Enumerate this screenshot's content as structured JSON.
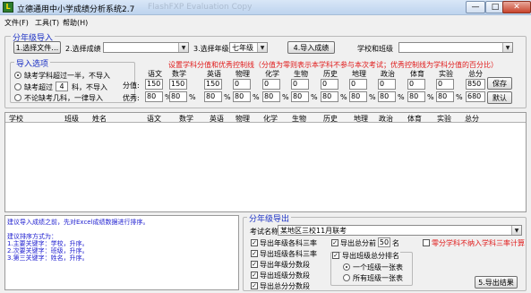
{
  "window": {
    "title": "立德通用中小学成绩分析系统2.7",
    "watermark": "FlashFXP Evaluation Copy",
    "btn_min": "—",
    "btn_max": "□",
    "btn_close": "✕"
  },
  "menu": {
    "file": "文件(F)",
    "tools": "工具(T)",
    "help": "帮助(H)"
  },
  "import_group": {
    "title": "分年级导入",
    "select_file": "1.选择文件…",
    "select_score_label": "2.选择成绩",
    "select_score_value": "",
    "select_grade_label": "3.选择年级",
    "select_grade_value": "七年级",
    "import_button": "4.导入成绩",
    "school_class_label": "学校和班级",
    "school_class_value": ""
  },
  "import_options": {
    "title": "导入选项",
    "opt1": "缺考学科超过一半，不导入",
    "opt2_pre": "缺考超过",
    "opt2_value": "4",
    "opt2_post": "科，不导入",
    "opt3": "不论缺考几科，一律导入"
  },
  "score_settings": {
    "hint": "设置学科分值和优秀控制线（分值为零则表示本学科不参与本次考试；优秀控制线为学科分值的百分比）",
    "subjects": [
      "语文",
      "数学",
      "英语",
      "物理",
      "化学",
      "生物",
      "历史",
      "地理",
      "政治",
      "体育",
      "实验",
      "总分"
    ],
    "score_label": "分值:",
    "scores": [
      "150",
      "150",
      "150",
      "0",
      "0",
      "0",
      "0",
      "0",
      "0",
      "0",
      "0",
      "850"
    ],
    "excellent_label": "优秀:",
    "excellent": [
      "80",
      "80",
      "80",
      "80",
      "80",
      "80",
      "80",
      "80",
      "80",
      "80",
      "80",
      "680"
    ],
    "percent_sign": "%",
    "save_button": "保存",
    "default_button": "默认"
  },
  "table": {
    "headers": [
      "学校",
      "班级",
      "姓名",
      "语文",
      "数学",
      "英语",
      "物理",
      "化学",
      "生物",
      "历史",
      "地理",
      "政治",
      "体育",
      "实验",
      "总分"
    ]
  },
  "notes": {
    "lines": [
      "建议导入成绩之前，先对Excel成绩数据进行排序。",
      "",
      "建议排序方式为：",
      "1.主要关键字：学校，升序。",
      "2.次要关键字：班级，升序。",
      "3.第三关键字：姓名，升序。"
    ]
  },
  "export_group": {
    "title": "分年级导出",
    "exam_label": "考试名称",
    "exam_value": "某地区三校11月联考",
    "cb1": "导出年级各科三率",
    "cb2": "导出班级各科三率",
    "cb3": "导出年级分数段",
    "cb4": "导出班级分数段",
    "cb5": "导出总分分数段",
    "cb6": "导出总分名次段",
    "top_pre": "导出总分前",
    "top_value": "50",
    "top_post": "名",
    "rank_label": "导出班级总分排名",
    "rank_opt1": "一个班级一张表",
    "rank_opt2": "所有班级一张表",
    "zero_label": "零分学科不纳入学科三率计算",
    "export_button": "5.导出结果"
  },
  "colors": {
    "accent": "#1a2fc4",
    "notes_text": "#2020d0",
    "hint_red": "#e01a1a",
    "zero_label_red": "#e01a1a"
  }
}
